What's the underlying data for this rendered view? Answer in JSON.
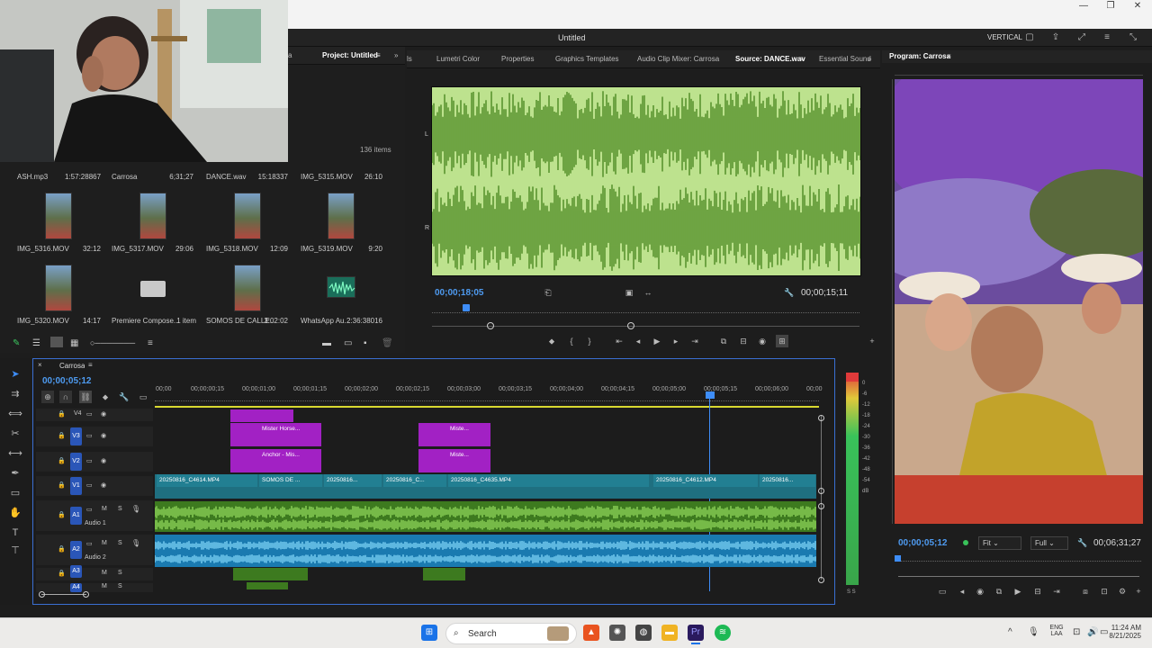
{
  "window": {
    "title": "Untitled",
    "workspace": "VERTICAL"
  },
  "project_panel": {
    "tab_partial": "a",
    "tab": "Project: Untitled",
    "item_count": "136 items",
    "top_row": [
      {
        "name": "ASH.mp3",
        "duration": "1:57:28867"
      },
      {
        "name": "Carrosa",
        "duration": "6;31;27"
      },
      {
        "name": "DANCE.wav",
        "duration": "15:18337"
      },
      {
        "name": "IMG_5315.MOV",
        "duration": "26:10"
      }
    ],
    "row2": [
      {
        "name": "IMG_5316.MOV",
        "duration": "32:12"
      },
      {
        "name": "IMG_5317.MOV",
        "duration": "29:06"
      },
      {
        "name": "IMG_5318.MOV",
        "duration": "12:09"
      },
      {
        "name": "IMG_5319.MOV",
        "duration": "9:20"
      }
    ],
    "row3": [
      {
        "name": "IMG_5320.MOV",
        "duration": "14:17"
      },
      {
        "name": "Premiere Compose...",
        "duration": "1 item"
      },
      {
        "name": "SOMOS DE CALLE...",
        "duration": "3:02:02"
      },
      {
        "name": "WhatsApp Au...",
        "duration": "2:36:38016"
      }
    ]
  },
  "source_tabs": {
    "partial": "ls",
    "items": [
      "Lumetri Color",
      "Properties",
      "Graphics Templates",
      "Audio Clip Mixer: Carrosa",
      "Source: DANCE.wav",
      "Essential Sound"
    ]
  },
  "source_monitor": {
    "timecode_current": "00;00;18;05",
    "timecode_duration": "00;00;15;11",
    "channel_top": "L",
    "channel_bottom": "R"
  },
  "program_monitor": {
    "title": "Program: Carrosa",
    "timecode_current": "00;00;05;12",
    "timecode_duration": "00;06;31;27",
    "fit": "Fit",
    "quality": "Full"
  },
  "timeline": {
    "sequence": "Carrosa",
    "timecode": "00;00;05;12",
    "ruler": [
      "00;00",
      "00;00;00;15",
      "00;00;01;00",
      "00;00;01;15",
      "00;00;02;00",
      "00;00;02;15",
      "00;00;03;00",
      "00;00;03;15",
      "00;00;04;00",
      "00;00;04;15",
      "00;00;05;00",
      "00;00;05;15",
      "00;00;06;00",
      "00;00"
    ],
    "tracks": {
      "v4": "V4",
      "v3": "V3",
      "v2": "V2",
      "v1": "V1",
      "a1": "A1",
      "a1_name": "Audio 1",
      "a2": "A2",
      "a2_name": "Audio 2",
      "a3": "A3",
      "a4": "A4"
    },
    "clips": {
      "v3a": "Mister Horse...",
      "v3b": "Miste...",
      "v2a": "Anchor - Mis...",
      "v2b": "Miste...",
      "v1": [
        "20250816_C4614.MP4",
        "SOMOS DE ...",
        "20250816...",
        "20250816_C...",
        "20250816_C4635.MP4",
        "20250816_C4612.MP4",
        "20250816..."
      ]
    },
    "meter_labels": [
      "0",
      "-6",
      "-12",
      "-18",
      "-24",
      "-30",
      "-36",
      "-42",
      "-48",
      "-54",
      "dB"
    ],
    "meter_channels": "S S"
  },
  "taskbar": {
    "search": "Search",
    "lang_top": "ENG",
    "lang_bottom": "LAA",
    "time": "11:24 AM",
    "date": "8/21/2025"
  }
}
